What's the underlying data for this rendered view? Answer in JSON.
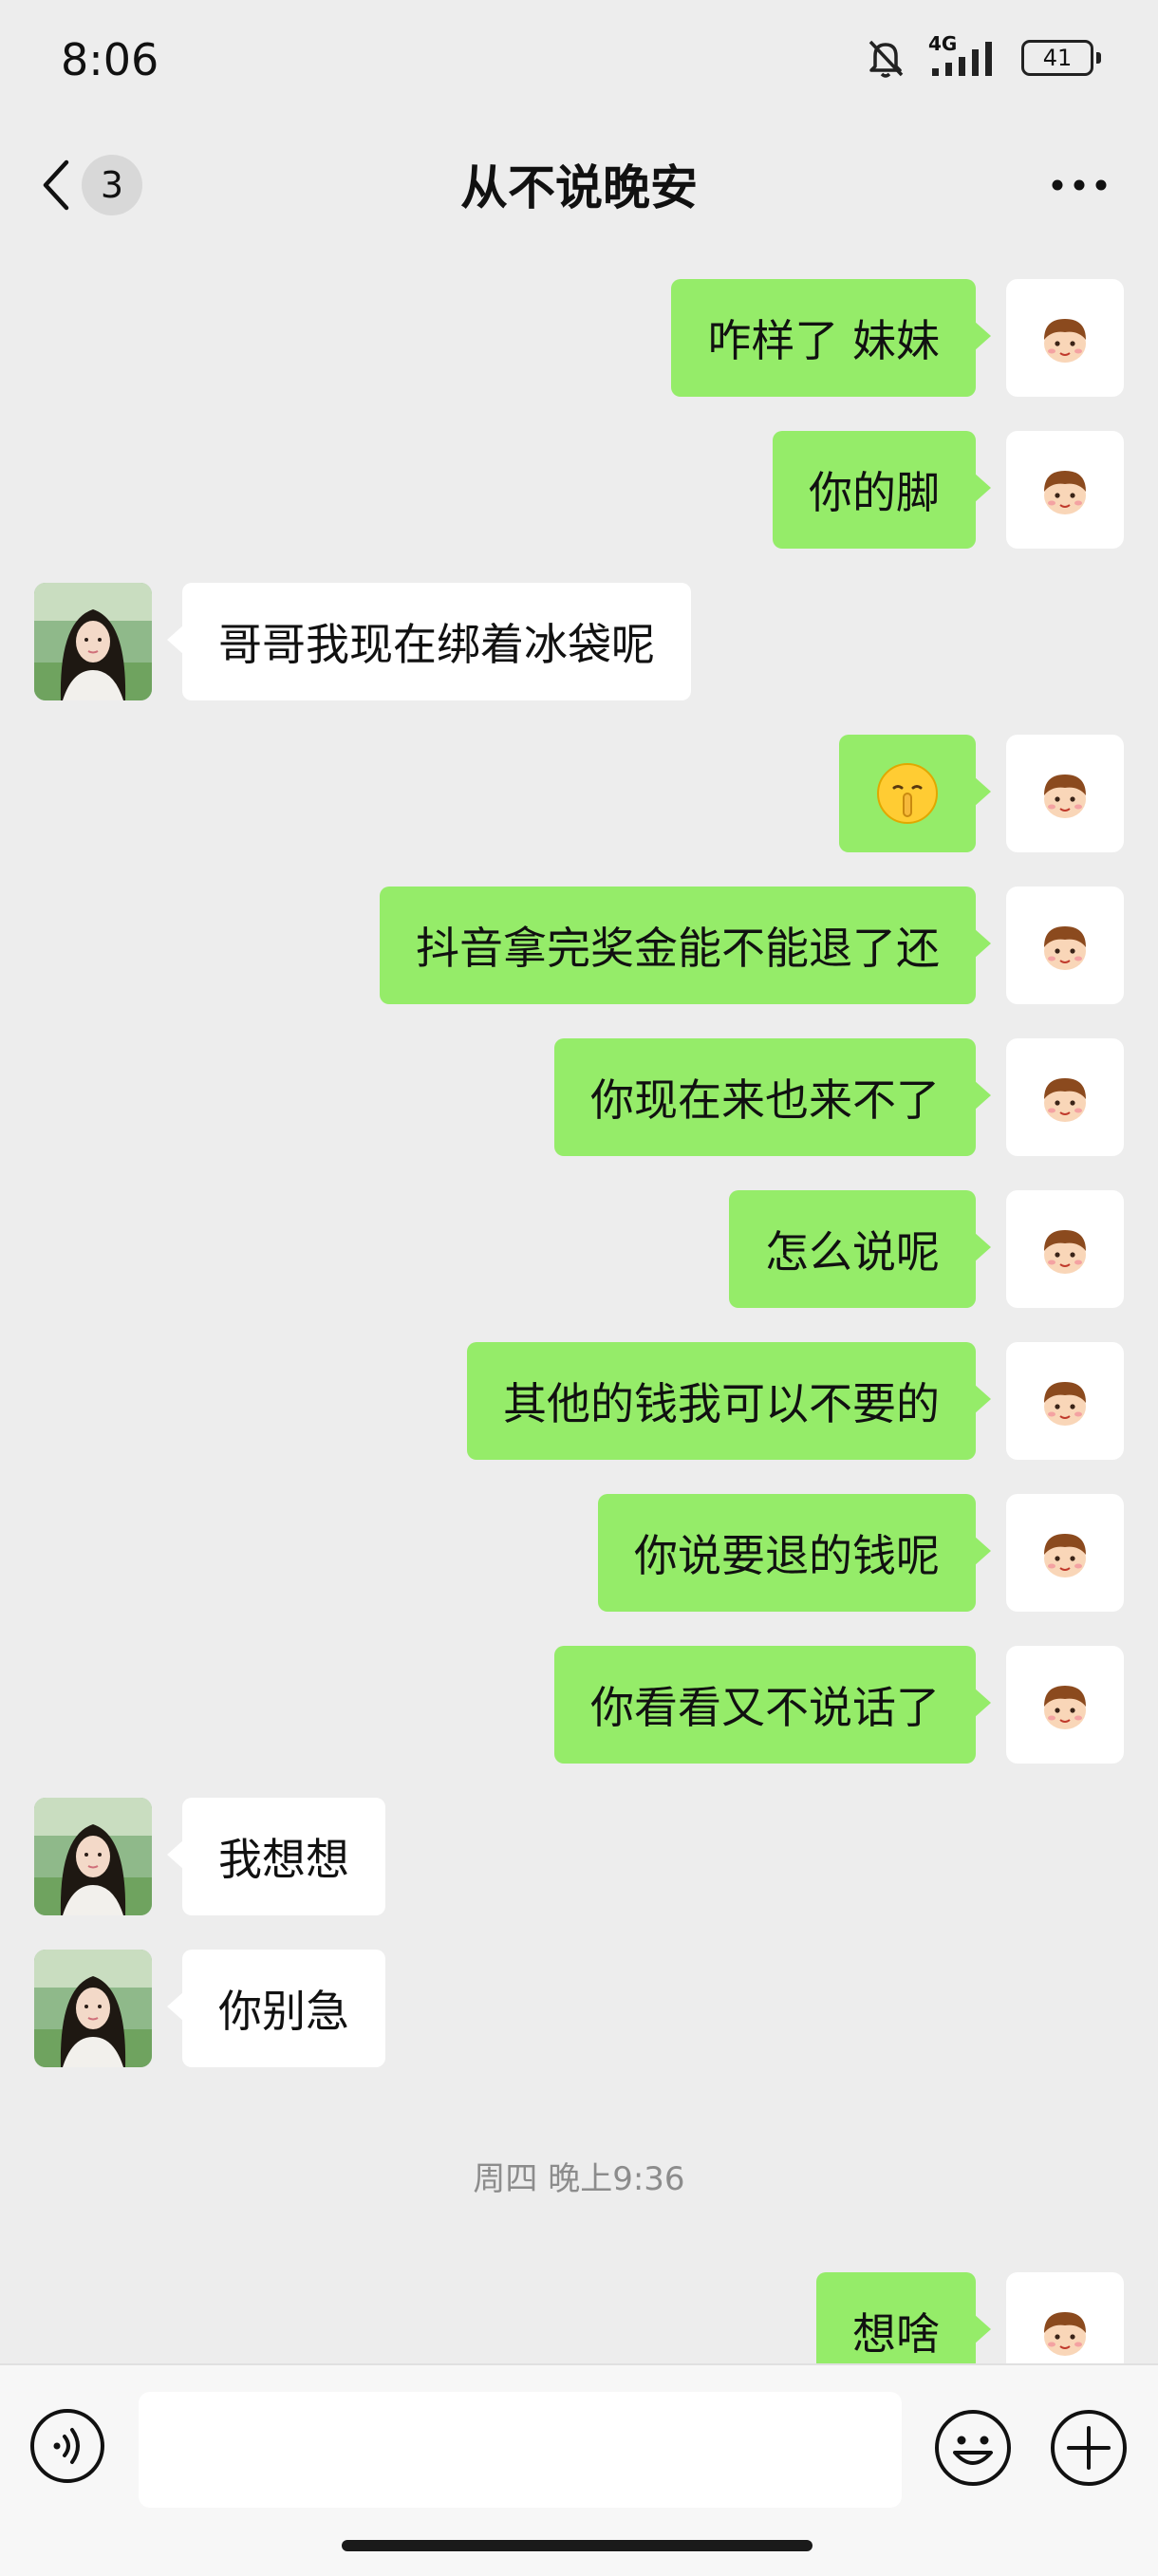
{
  "status_bar": {
    "time": "8:06",
    "network": "4G",
    "battery": "41"
  },
  "header": {
    "unread_count": "3",
    "title": "从不说晚安"
  },
  "messages": [
    {
      "from": "me",
      "text": "咋样了  妹妹"
    },
    {
      "from": "me",
      "text": "你的脚"
    },
    {
      "from": "other",
      "text": "哥哥我现在绑着冰袋呢"
    },
    {
      "from": "me",
      "emoji": "shushing-face-emoji"
    },
    {
      "from": "me",
      "text": "抖音拿完奖金能不能退了还"
    },
    {
      "from": "me",
      "text": "你现在来也来不了"
    },
    {
      "from": "me",
      "text": "怎么说呢"
    },
    {
      "from": "me",
      "text": "其他的钱我可以不要的"
    },
    {
      "from": "me",
      "text": "你说要退的钱呢"
    },
    {
      "from": "me",
      "text": "你看看又不说话了"
    },
    {
      "from": "other",
      "text": "我想想"
    },
    {
      "from": "other",
      "text": "你别急"
    },
    {
      "timestamp": "周四 晚上9:36"
    },
    {
      "from": "me",
      "text": "想啥"
    }
  ],
  "colors": {
    "background": "#EDEDED",
    "my_bubble": "#95EC69",
    "other_bubble": "#FFFFFF",
    "timestamp_text": "#8C8C8C"
  },
  "icons": {
    "back": "chevron-left-icon",
    "more": "more-dots-icon",
    "mute": "bell-off-icon",
    "signal": "signal-icon",
    "voice": "voice-input-icon",
    "emoji": "emoji-icon",
    "plus": "plus-icon"
  },
  "input": {
    "value": ""
  }
}
